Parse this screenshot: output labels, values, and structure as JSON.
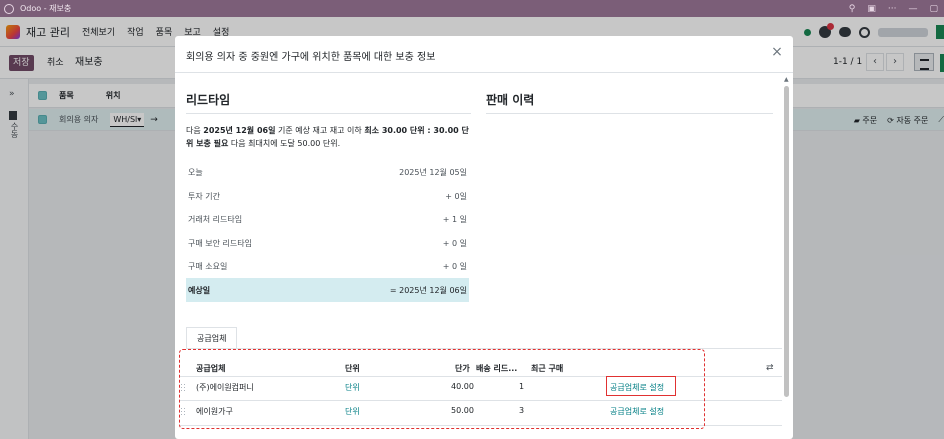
{
  "window": {
    "title": "Odoo - 재보충"
  },
  "nav": {
    "app_name": "재고 관리",
    "menu": [
      "전체보기",
      "작업",
      "품목",
      "보고",
      "설정"
    ]
  },
  "control": {
    "save": "저장",
    "discard": "취소",
    "breadcrumb": "재보충",
    "pager": "1-1 / 1",
    "prev": "‹",
    "next": "›"
  },
  "side_panel": {
    "label": "수동"
  },
  "list": {
    "headers": [
      "품목",
      "위치"
    ],
    "row": {
      "product": "회의용 의자",
      "location": "WH/Sl▾",
      "arrow": "→"
    },
    "actions": [
      "주문",
      "자동 주문"
    ]
  },
  "modal": {
    "title": "회의용 의자 중 중원엔 가구에 위치한 품목에 대한 보충 정보",
    "close": "×",
    "lead_time": {
      "heading": "리드타임",
      "desc_pre": "다음 ",
      "desc_date": "2025년 12월 06일",
      "desc_mid": " 기준 예상 재고 재고 이하 ",
      "desc_min": "최소 30.00 단위 : 30.00 단위 보충 필요",
      "desc_post": " 다음 최대치에 도달 50.00 단위.",
      "rows": [
        {
          "label": "오늘",
          "value": "2025년 12월 05일"
        },
        {
          "label": "투자 기간",
          "value": "+ 0일"
        },
        {
          "label": "거래처 리드타임",
          "value": "+ 1 일"
        },
        {
          "label": "구매 보안 리드타임",
          "value": "+ 0 일"
        },
        {
          "label": "구매 소요일",
          "value": "+ 0 일"
        }
      ],
      "total": {
        "label": "예상일",
        "value": "= 2025년 12월 06일"
      }
    },
    "sales_history": {
      "heading": "판매 이력"
    },
    "tab": "공급업체",
    "table": {
      "headers": [
        "공급업체",
        "단위",
        "단가",
        "배송 리드...",
        "최근 구매"
      ],
      "rows": [
        {
          "vendor": "(주)에이원컴퍼니",
          "unit": "단위",
          "price": "40.00",
          "lead": "1",
          "action": "공급업체로 설정"
        },
        {
          "vendor": "에이원가구",
          "unit": "단위",
          "price": "50.00",
          "lead": "3",
          "action": "공급업체로 설정"
        }
      ]
    }
  }
}
